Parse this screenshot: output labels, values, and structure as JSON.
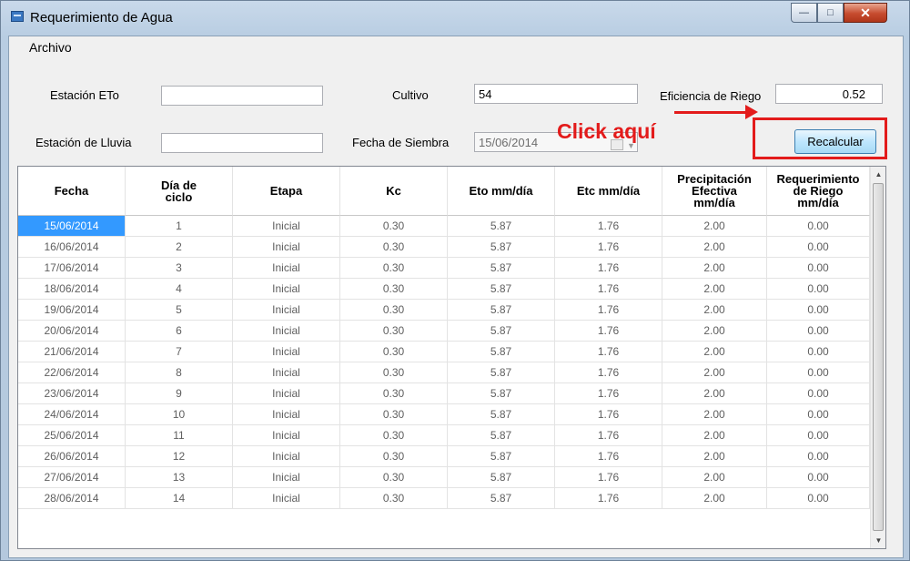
{
  "window": {
    "title": "Requerimiento de Agua",
    "min": "—",
    "max": "□",
    "close": "✕"
  },
  "menu": {
    "file": "Archivo"
  },
  "form": {
    "eto_station_label": "Estación ETo",
    "eto_station_value": "",
    "rain_station_label": "Estación de Lluvia",
    "rain_station_value": "",
    "crop_label": "Cultivo",
    "crop_value": "54",
    "sowing_date_label": "Fecha de Siembra",
    "sowing_date_value": "15/06/2014",
    "efficiency_label": "Eficiencia de Riego",
    "efficiency_value": "0.52",
    "recalc_label": "Recalcular"
  },
  "annotation": {
    "text": "Click aquí",
    "color": "#e31b1b"
  },
  "table": {
    "headers": [
      "Fecha",
      "Día de\nciclo",
      "Etapa",
      "Kc",
      "Eto mm/día",
      "Etc mm/día",
      "Precipitación\nEfectiva\nmm/día",
      "Requerimiento\nde Riego\nmm/día"
    ],
    "rows": [
      [
        "15/06/2014",
        "1",
        "Inicial",
        "0.30",
        "5.87",
        "1.76",
        "2.00",
        "0.00"
      ],
      [
        "16/06/2014",
        "2",
        "Inicial",
        "0.30",
        "5.87",
        "1.76",
        "2.00",
        "0.00"
      ],
      [
        "17/06/2014",
        "3",
        "Inicial",
        "0.30",
        "5.87",
        "1.76",
        "2.00",
        "0.00"
      ],
      [
        "18/06/2014",
        "4",
        "Inicial",
        "0.30",
        "5.87",
        "1.76",
        "2.00",
        "0.00"
      ],
      [
        "19/06/2014",
        "5",
        "Inicial",
        "0.30",
        "5.87",
        "1.76",
        "2.00",
        "0.00"
      ],
      [
        "20/06/2014",
        "6",
        "Inicial",
        "0.30",
        "5.87",
        "1.76",
        "2.00",
        "0.00"
      ],
      [
        "21/06/2014",
        "7",
        "Inicial",
        "0.30",
        "5.87",
        "1.76",
        "2.00",
        "0.00"
      ],
      [
        "22/06/2014",
        "8",
        "Inicial",
        "0.30",
        "5.87",
        "1.76",
        "2.00",
        "0.00"
      ],
      [
        "23/06/2014",
        "9",
        "Inicial",
        "0.30",
        "5.87",
        "1.76",
        "2.00",
        "0.00"
      ],
      [
        "24/06/2014",
        "10",
        "Inicial",
        "0.30",
        "5.87",
        "1.76",
        "2.00",
        "0.00"
      ],
      [
        "25/06/2014",
        "11",
        "Inicial",
        "0.30",
        "5.87",
        "1.76",
        "2.00",
        "0.00"
      ],
      [
        "26/06/2014",
        "12",
        "Inicial",
        "0.30",
        "5.87",
        "1.76",
        "2.00",
        "0.00"
      ],
      [
        "27/06/2014",
        "13",
        "Inicial",
        "0.30",
        "5.87",
        "1.76",
        "2.00",
        "0.00"
      ],
      [
        "28/06/2014",
        "14",
        "Inicial",
        "0.30",
        "5.87",
        "1.76",
        "2.00",
        "0.00"
      ]
    ],
    "selected_row": 0,
    "scroll_up": "▲",
    "scroll_down": "▼"
  }
}
